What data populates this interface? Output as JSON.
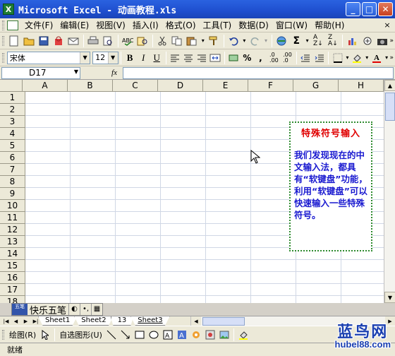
{
  "window": {
    "title": "Microsoft Excel - 动画教程.xls",
    "app_icon": "X",
    "buttons": [
      "minimize",
      "maximize",
      "close"
    ]
  },
  "menu": {
    "items": [
      "文件(F)",
      "编辑(E)",
      "视图(V)",
      "插入(I)",
      "格式(O)",
      "工具(T)",
      "数据(D)",
      "窗口(W)",
      "帮助(H)"
    ],
    "close_glyph": "×"
  },
  "format_toolbar": {
    "font_name": "宋体",
    "font_size": "12",
    "bold": "B",
    "italic": "I",
    "underline": "U",
    "percent": "%",
    "comma": ","
  },
  "formula_bar": {
    "name_box": "D17",
    "fx": "fx",
    "formula": ""
  },
  "grid": {
    "columns": [
      "A",
      "B",
      "C",
      "D",
      "E",
      "F",
      "G",
      "H"
    ],
    "rows": [
      "1",
      "2",
      "3",
      "4",
      "5",
      "6",
      "7",
      "8",
      "9",
      "10",
      "11",
      "12",
      "13",
      "14",
      "15",
      "16",
      "17",
      "18"
    ]
  },
  "callout": {
    "title": "特殊符号输入",
    "body": "我们发现现在的中文输入法，都具有“软键盘”功能，利用“软键盘”可以快速输入一些特殊符号。",
    "title_color": "#e00000",
    "body_color": "#1a1ad0",
    "border_color": "#2e8b2e"
  },
  "ime_bar": {
    "icon_text": "五笔",
    "name": "快乐五笔",
    "moon": "◐",
    "punct": "•,",
    "keyboard": "▦"
  },
  "sheet_tabs": {
    "tabs": [
      "Sheet1",
      "Sheet2",
      "13",
      "Sheet3"
    ],
    "active": "Sheet3"
  },
  "drawing_toolbar": {
    "draw_label": "绘图(R)",
    "autoshapes_label": "自选图形(U)"
  },
  "status": {
    "text": "就绪"
  },
  "watermark": {
    "cn": "蓝鸟网",
    "url": "hubel88.com"
  }
}
